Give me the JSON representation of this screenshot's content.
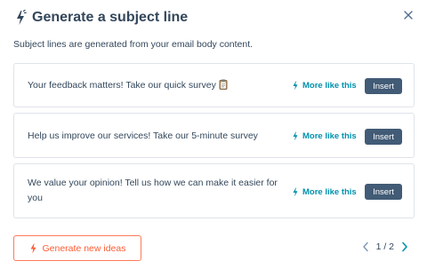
{
  "dialog": {
    "title": "Generate a subject line",
    "subtitle": "Subject lines are generated from your email body content."
  },
  "suggestions": [
    {
      "text": "Your feedback matters! Take our quick survey",
      "emoji_icon": "clipboard-icon",
      "more_label": "More like this",
      "insert_label": "Insert"
    },
    {
      "text": "Help us improve our services! Take our 5-minute survey",
      "more_label": "More like this",
      "insert_label": "Insert"
    },
    {
      "text": "We value your opinion! Tell us how we can make it easier for you",
      "more_label": "More like this",
      "insert_label": "Insert"
    }
  ],
  "footer": {
    "generate_label": "Generate new ideas",
    "pager": {
      "current": 1,
      "total": 2,
      "text": "1 / 2"
    }
  },
  "colors": {
    "heading": "#33475b",
    "link": "#0091ae",
    "insert_bg": "#425b76",
    "accent": "#ff5c35",
    "border": "#dfe3eb"
  }
}
